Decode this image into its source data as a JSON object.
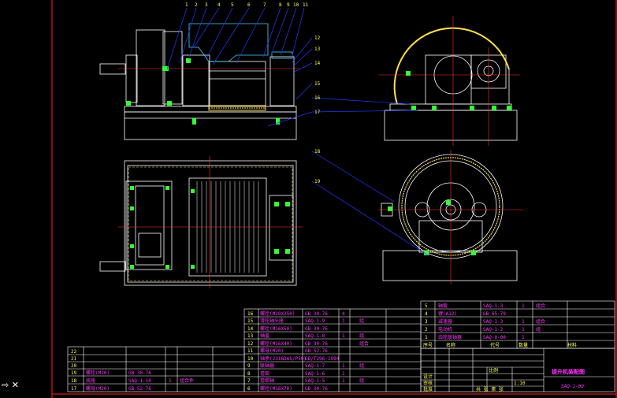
{
  "colors": {
    "background": "#000000",
    "frame": "#ff2222",
    "outline": "#ffffff",
    "centerline": "#ff3333",
    "leader": "#1e3cff",
    "bolt": "#33ff33",
    "fill_yellow": "#ffe14a",
    "hatch_cyan": "#4ad0ff",
    "text_magenta": "#ff33ff",
    "text_yellow": "#ffff55"
  },
  "callouts_top": [
    "1",
    "2",
    "3",
    "4",
    "5",
    "6",
    "7",
    "8",
    "9",
    "10",
    "11"
  ],
  "callouts_right": [
    "12",
    "13",
    "14",
    "15",
    "16",
    "17"
  ],
  "callouts_lower": [
    "18",
    "19"
  ],
  "parts_left": [
    {
      "no": "22",
      "name": "",
      "std": "",
      "qty": "",
      "mat": ""
    },
    {
      "no": "21",
      "name": "",
      "std": "",
      "qty": "",
      "mat": ""
    },
    {
      "no": "20",
      "name": "",
      "std": "",
      "qty": "",
      "mat": ""
    },
    {
      "no": "19",
      "name": "螺栓(M20)",
      "std": "GB 30-76",
      "qty": "",
      "mat": ""
    },
    {
      "no": "18",
      "name": "底座",
      "std": "SAQ-1-10",
      "qty": "1",
      "mat": "组合件"
    },
    {
      "no": "17",
      "name": "螺母(M20)",
      "std": "GB 52-76",
      "qty": "",
      "mat": ""
    }
  ],
  "parts_mid": [
    {
      "no": "16",
      "name": "螺栓(M20X250)",
      "std": "GB 30-76",
      "qty": "4",
      "mat": ""
    },
    {
      "no": "15",
      "name": "滑轮轴头座",
      "std": "SAQ-1-9",
      "qty": "1",
      "mat": "组"
    },
    {
      "no": "14",
      "name": "螺栓(M16X50)",
      "std": "GB 30-76",
      "qty": "",
      "mat": ""
    },
    {
      "no": "13",
      "name": "轴盖",
      "std": "SAQ-1-8",
      "qty": "1",
      "mat": "组"
    },
    {
      "no": "12",
      "name": "螺栓(M16X40)",
      "std": "GB 30-76",
      "qty": "",
      "mat": "组合"
    },
    {
      "no": "11",
      "name": "螺母(M20)",
      "std": "GB 52-76",
      "qty": "",
      "mat": ""
    },
    {
      "no": "10",
      "name": "轴承(2316DAS/P50)",
      "std": "GB/T296-1994",
      "qty": "",
      "mat": ""
    },
    {
      "no": "9",
      "name": "联轴器",
      "std": "SAQ-1-7",
      "qty": "1",
      "mat": "组"
    },
    {
      "no": "8",
      "name": "卷筒",
      "std": "SAQ-1-6",
      "qty": "1",
      "mat": ""
    },
    {
      "no": "7",
      "name": "卷筒轴",
      "std": "SAQ-1-5",
      "qty": "1",
      "mat": "组"
    },
    {
      "no": "6",
      "name": "螺栓(M16X70)",
      "std": "GB 30-76",
      "qty": "",
      "mat": ""
    }
  ],
  "parts_right": [
    {
      "no": "5",
      "name": "轴套",
      "std": "SAQ-1-3",
      "qty": "1",
      "mat": "组合"
    },
    {
      "no": "4",
      "name": "键(A32)",
      "std": "GB 65-79",
      "qty": "",
      "mat": ""
    },
    {
      "no": "3",
      "name": "减速器",
      "std": "SAQ-1-3",
      "qty": "1",
      "mat": "组合"
    },
    {
      "no": "2",
      "name": "电动机",
      "std": "SAQ-1-2",
      "qty": "1",
      "mat": "组"
    },
    {
      "no": "1",
      "name": "齿轮联轴器",
      "std": "SAQ-0-00",
      "qty": "1",
      "mat": ""
    }
  ],
  "header_row": {
    "no": "序号",
    "name": "名称",
    "std": "代号",
    "qty": "数量",
    "mat": "材料"
  },
  "title_block": {
    "drawing_title": "提升机装配图",
    "drawing_number": "SAQ-1-00",
    "scale_label": "比例",
    "scale": "1:10",
    "sheet": "共 张  第 张",
    "designer": "设计",
    "checker": "审核",
    "approver": "批准"
  },
  "cursor_glyph": "⇨ ✕"
}
